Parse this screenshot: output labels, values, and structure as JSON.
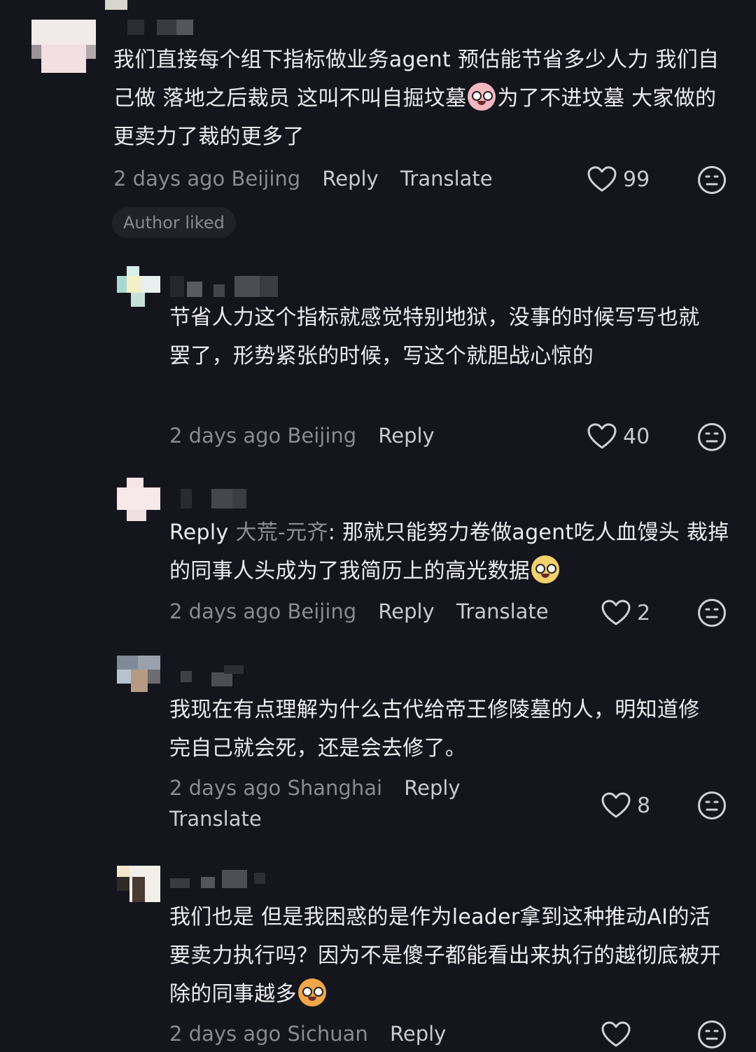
{
  "comments": [
    {
      "text": "我们直接每个组下指标做业务agent 预估能节省多少人力 我们自己做 落地之后裁员 这叫不叫自掘坟墓",
      "text_after_emoji": "为了不进坟墓 大家做的更卖力了裁的更多了",
      "emoji": "scared-face-emoji",
      "time": "2 days ago",
      "location": "Beijing",
      "reply_label": "Reply",
      "translate_label": "Translate",
      "likes": "99",
      "badge": "Author liked"
    },
    {
      "text": "节省人力这个指标就感觉特别地狱，没事的时候写写也就罢了，形势紧张的时候，写这个就胆战心惊的",
      "time": "2 days ago",
      "location": "Beijing",
      "reply_label": "Reply",
      "likes": "40"
    },
    {
      "reply_prefix": "Reply",
      "quoted_user": "大荒-元齐",
      "text": ": 那就只能努力卷做agent吃人血馒头 裁掉的同事人头成为了我简历上的高光数据",
      "emoji": "smug-face-emoji",
      "time": "2 days ago",
      "location": "Beijing",
      "reply_label": "Reply",
      "translate_label": "Translate",
      "likes": "2"
    },
    {
      "text": "我现在有点理解为什么古代给帝王修陵墓的人，明知道修完自己就会死，还是会去修了。",
      "time": "2 days ago",
      "location": "Shanghai",
      "reply_label": "Reply",
      "translate_label": "Translate",
      "likes": "8"
    },
    {
      "text": "我们也是 但是我困惑的是作为leader拿到这种推动AI的活要卖力执行吗？因为不是傻子都能看出来执行的越彻底被开除的同事越多",
      "emoji": "crying-cat-emoji",
      "time": "2 days ago",
      "location": "Sichuan",
      "reply_label": "Reply",
      "likes": ""
    }
  ],
  "icons": {
    "like": "heart-outline-icon",
    "dislike": "neutral-face-icon"
  },
  "colors": {
    "background": "#15151d",
    "text": "#ececf0",
    "meta": "#8a8a92",
    "action": "#c9c9cf"
  }
}
